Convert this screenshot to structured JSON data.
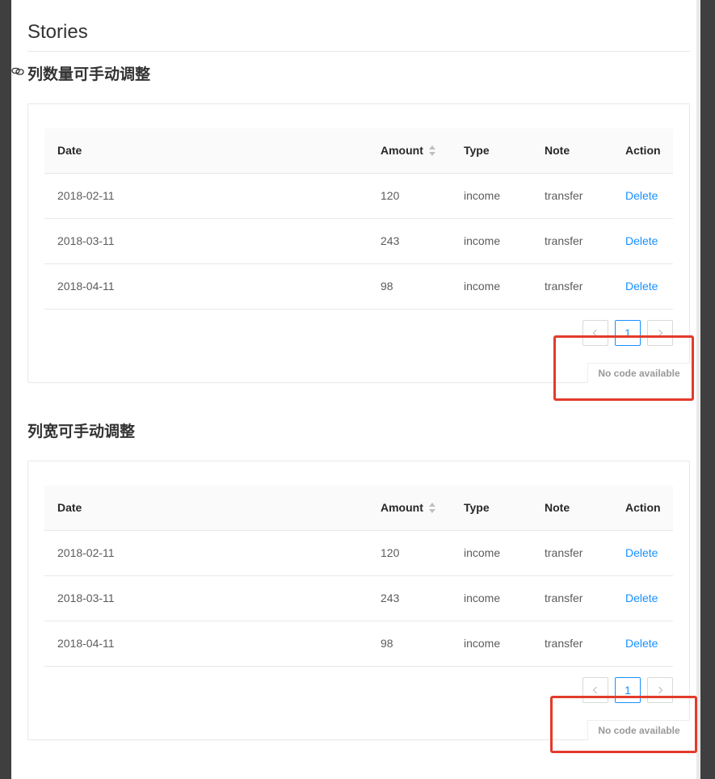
{
  "page": {
    "title": "Stories"
  },
  "sections": [
    {
      "heading": "列数量可手动调整",
      "table": {
        "columns": [
          "Date",
          "Amount",
          "Type",
          "Note",
          "Action"
        ],
        "rows": [
          {
            "date": "2018-02-11",
            "amount": "120",
            "type": "income",
            "note": "transfer",
            "action": "Delete"
          },
          {
            "date": "2018-03-11",
            "amount": "243",
            "type": "income",
            "note": "transfer",
            "action": "Delete"
          },
          {
            "date": "2018-04-11",
            "amount": "98",
            "type": "income",
            "note": "transfer",
            "action": "Delete"
          }
        ]
      },
      "pagination": {
        "current": "1"
      },
      "code_button": "No code available"
    },
    {
      "heading": "列宽可手动调整",
      "table": {
        "columns": [
          "Date",
          "Amount",
          "Type",
          "Note",
          "Action"
        ],
        "rows": [
          {
            "date": "2018-02-11",
            "amount": "120",
            "type": "income",
            "note": "transfer",
            "action": "Delete"
          },
          {
            "date": "2018-03-11",
            "amount": "243",
            "type": "income",
            "note": "transfer",
            "action": "Delete"
          },
          {
            "date": "2018-04-11",
            "amount": "98",
            "type": "income",
            "note": "transfer",
            "action": "Delete"
          }
        ]
      },
      "pagination": {
        "current": "1"
      },
      "code_button": "No code available"
    }
  ],
  "icons": {
    "anchor": "link-icon",
    "sort": "sort-icon",
    "prev": "chevron-left-icon",
    "next": "chevron-right-icon"
  },
  "colors": {
    "link": "#1890ff",
    "highlight": "#e23b2b",
    "header_bg": "#fafafa",
    "frame": "#3f3f3f"
  }
}
